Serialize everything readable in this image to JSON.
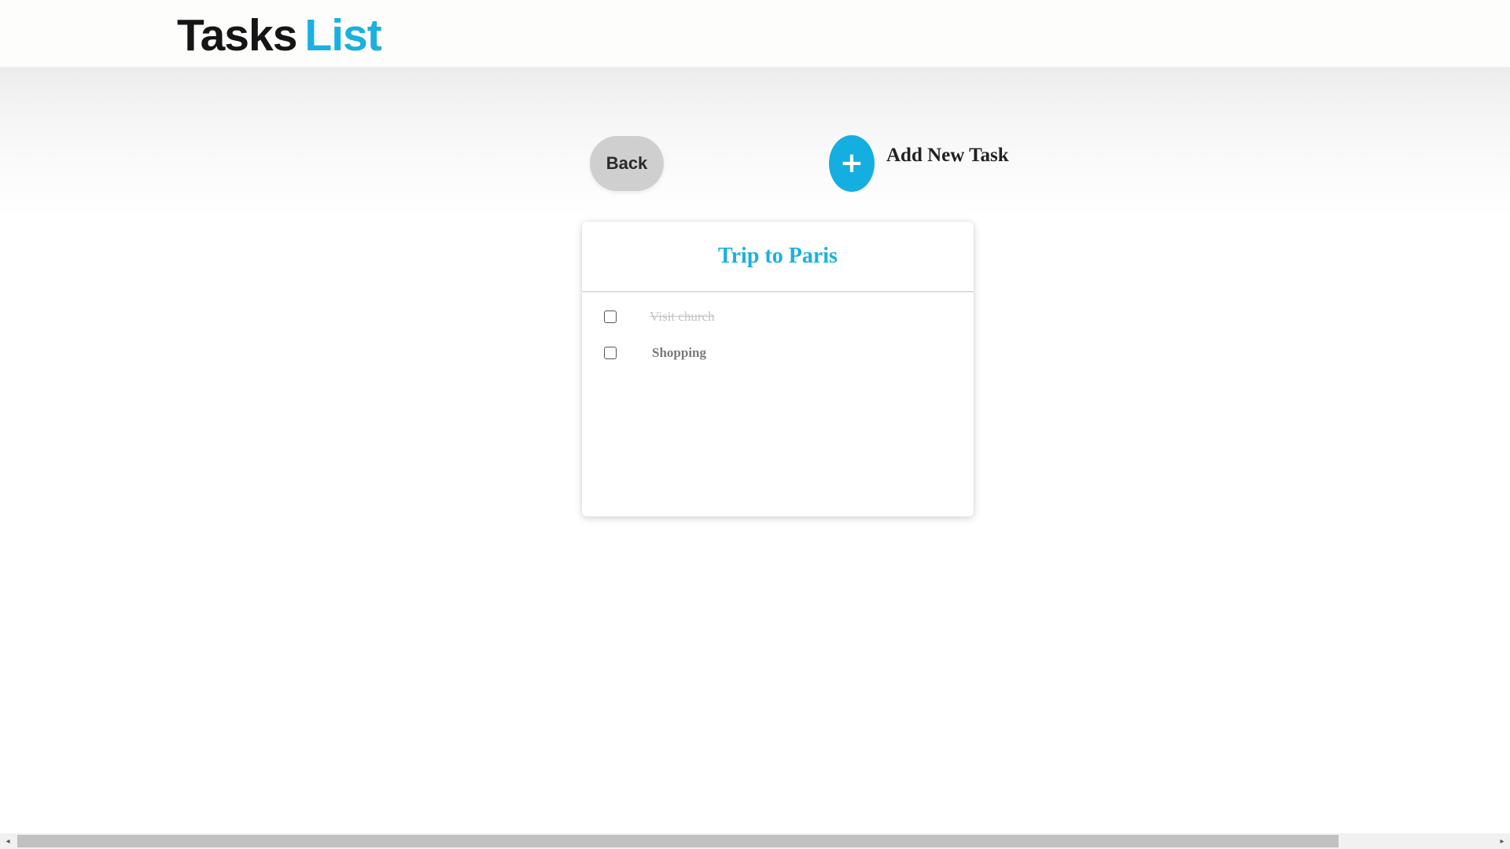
{
  "header": {
    "logo_word1": "Tasks",
    "logo_word2": "List"
  },
  "toolbar": {
    "back_label": "Back",
    "add_icon_glyph": "+",
    "add_label": "Add New Task"
  },
  "list": {
    "title": "Trip to Paris",
    "tasks": [
      {
        "label": "Visit church",
        "completed": true
      },
      {
        "label": "Shopping",
        "completed": false
      }
    ]
  },
  "scrollbar": {
    "left_arrow": "◂",
    "right_arrow": "▸"
  },
  "colors": {
    "accent": "#1ab0e0",
    "back_button": "#cfcfcf",
    "logo_dark": "#151515"
  }
}
